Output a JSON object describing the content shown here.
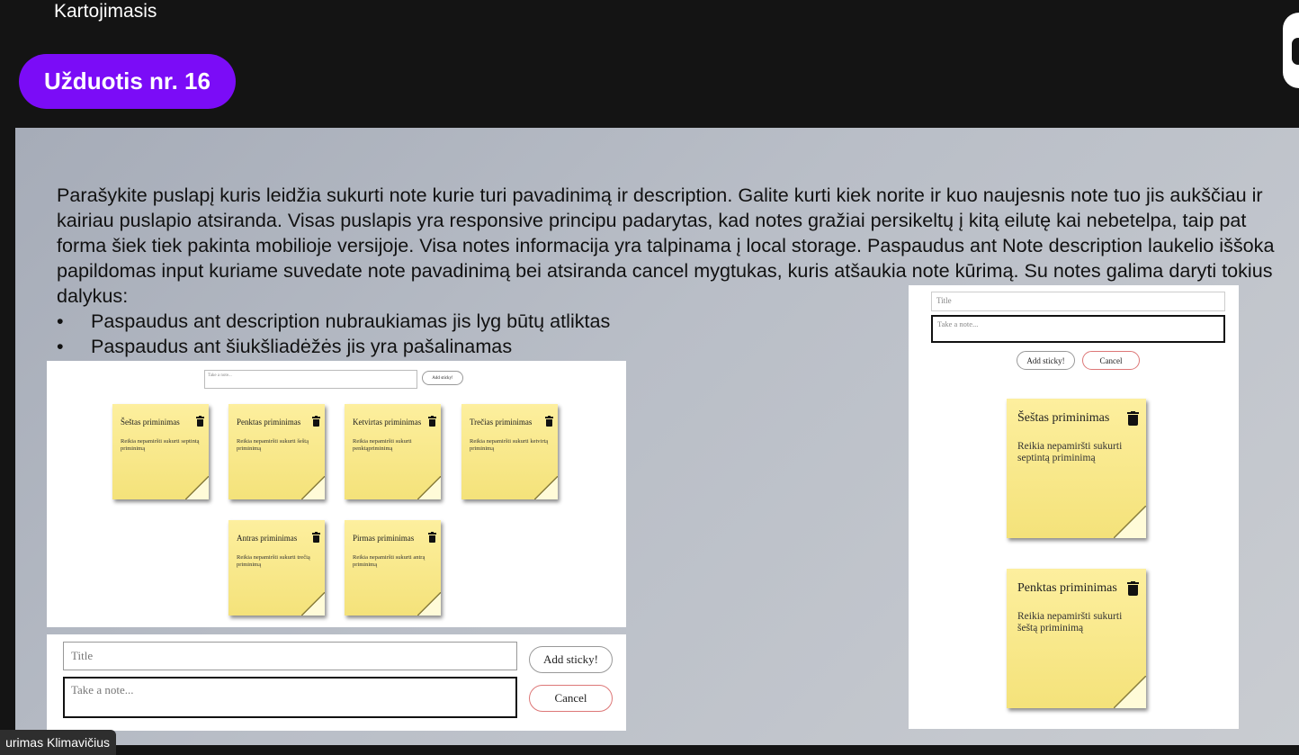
{
  "header": {
    "title": "Kartojimasis",
    "task_label": "Užduotis nr. 16"
  },
  "instructions": {
    "paragraph": "Parašykite puslapį kuris leidžia sukurti note kurie turi pavadinimą ir description. Galite kurti kiek norite ir kuo naujesnis note tuo jis aukščiau ir kairiau puslapio atsiranda. Visas puslapis yra responsive principu padarytas, kad notes gražiai persikeltų į kitą eilutę kai nebetelpa, taip pat forma šiek tiek pakinta mobilioje versijoje. Visa notes informacija yra talpinama į local storage. Paspaudus ant Note description laukelio iššoka papildomas input kuriame suvedate note pavadinimą bei atsiranda cancel mygtukas, kuris atšaukia note kūrimą. Su notes galima daryti tokius dalykus:",
    "bullets": [
      "Paspaudus ant description nubraukiamas jis lyg būtų atliktas",
      "Paspaudus ant šiukšliadėžės jis yra pašalinamas"
    ]
  },
  "desktop_preview": {
    "note_placeholder": "Take a note...",
    "add_label": "Add sticky!",
    "notes": [
      {
        "title": "Šeštas priminimas",
        "body": "Reikia nepamiršti sukurti septintą priminimą"
      },
      {
        "title": "Penktas priminimas",
        "body": "Reikia nepamiršti sukurti šeštą priminimą"
      },
      {
        "title": "Ketvirtas priminimas",
        "body": "Reikia nepamiršti sukurti penktąpriminimą"
      },
      {
        "title": "Trečias priminimas",
        "body": "Reikia nepamiršti sukurti ketvirtą priminimą"
      },
      {
        "title": "Antras priminimas",
        "body": "Reikia nepamiršti sukurti trečią priminimą"
      },
      {
        "title": "Pirmas priminimas",
        "body": "Reikia nepamiršti sukurti antrą priminimą"
      }
    ]
  },
  "mobile_preview": {
    "title_placeholder": "Title",
    "note_placeholder": "Take a note...",
    "add_label": "Add sticky!",
    "cancel_label": "Cancel",
    "notes": [
      {
        "title": "Šeštas priminimas",
        "body": "Reikia nepamiršti sukurti septintą priminimą"
      },
      {
        "title": "Penktas priminimas",
        "body": "Reikia nepamiršti sukurti šeštą priminimą"
      }
    ]
  },
  "form_preview": {
    "title_placeholder": "Title",
    "note_placeholder": "Take a note...",
    "add_label": "Add sticky!",
    "cancel_label": "Cancel"
  },
  "speaker_name": "urimas Klimavičius",
  "colors": {
    "accent": "#7b0cf7",
    "note_yellow": "#f6e47f",
    "background": "#141414"
  }
}
